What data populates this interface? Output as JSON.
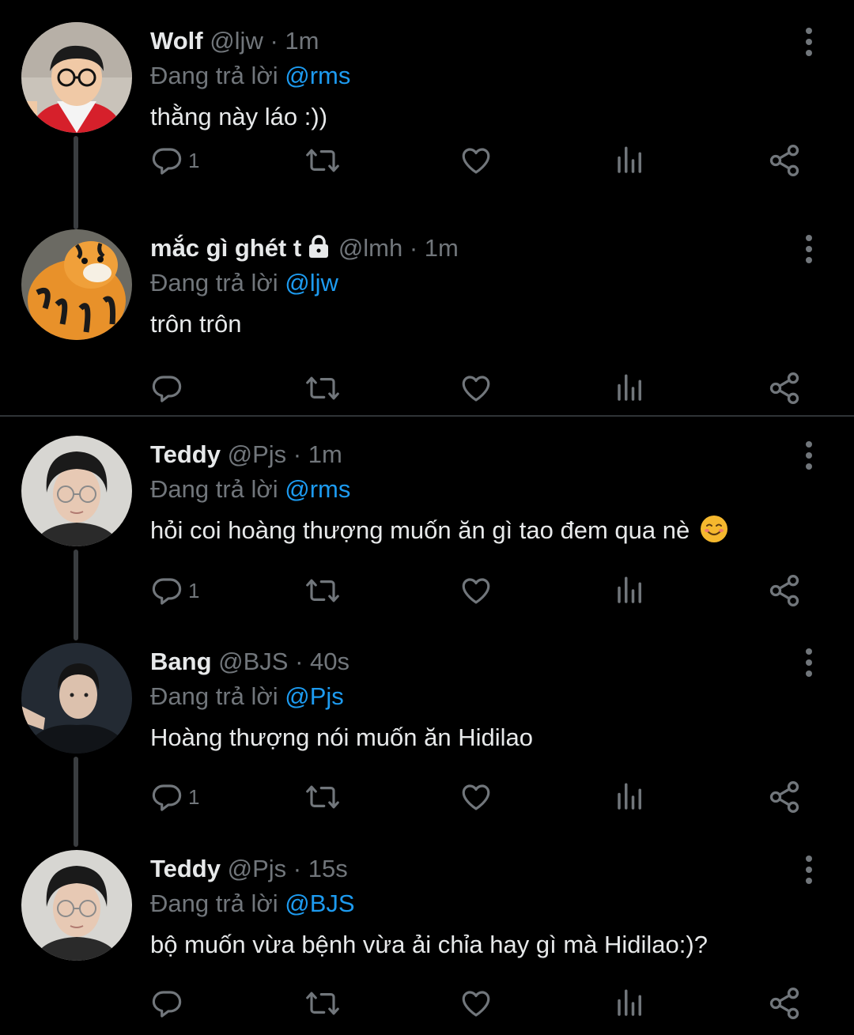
{
  "colors": {
    "background": "#000000",
    "text_primary": "#e7e9ea",
    "text_secondary": "#71767b",
    "mention": "#1d9bf0",
    "thread_line": "#3a3d40",
    "icon": "#71767b"
  },
  "reply_prefix": "Đang trả lời",
  "tweets": [
    {
      "name": "Wolf",
      "handle": "@ljw",
      "time": "· 1m",
      "reply_to": "@rms",
      "text": "thằng này láo :))",
      "reply_count": "1",
      "locked": false
    },
    {
      "name": "mắc gì ghét t",
      "handle": "@lmh",
      "time": "· 1m",
      "reply_to": "@ljw",
      "text": "trôn trôn",
      "reply_count": "",
      "locked": true
    },
    {
      "name": "Teddy",
      "handle": "@Pjs",
      "time": "· 1m",
      "reply_to": "@rms",
      "text": "hỏi coi hoàng thượng muốn ăn gì tao đem qua nè",
      "emoji": "smiling-face-icon",
      "reply_count": "1",
      "locked": false
    },
    {
      "name": "Bang",
      "handle": "@BJS",
      "time": "· 40s",
      "reply_to": "@Pjs",
      "text": "Hoàng thượng nói muốn ăn Hidilao",
      "reply_count": "1",
      "locked": false
    },
    {
      "name": "Teddy",
      "handle": "@Pjs",
      "time": "· 15s",
      "reply_to": "@BJS",
      "text": "bộ muốn vừa bệnh vừa ải chỉa hay gì mà Hidilao:)?",
      "reply_count": "",
      "locked": false
    }
  ],
  "icons": {
    "reply": "reply-icon",
    "retweet": "retweet-icon",
    "like": "heart-icon",
    "views": "views-icon",
    "share": "share-icon",
    "more": "more-options-icon",
    "lock": "lock-icon"
  }
}
